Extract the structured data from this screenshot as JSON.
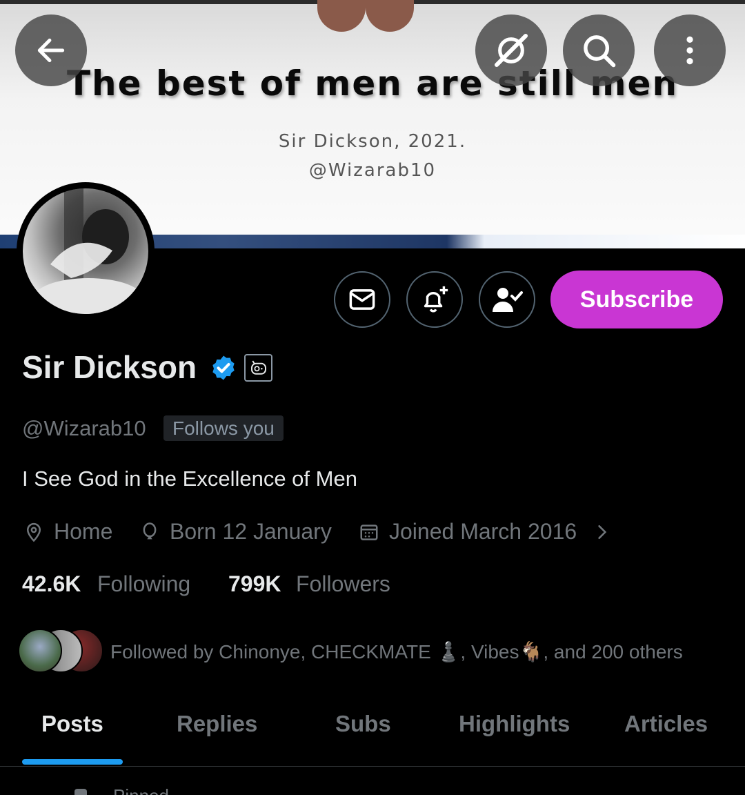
{
  "banner": {
    "quote": "The best of men are still men",
    "caption_line1": "Sir Dickson, 2021.",
    "caption_line2": "@Wizarab10"
  },
  "header_buttons": {
    "back": "back-arrow-icon",
    "grok": "grok-icon",
    "search": "search-icon",
    "more": "more-vertical-icon"
  },
  "actions": {
    "message": "mail-icon",
    "notify": "bell-plus-icon",
    "following": "user-check-icon",
    "subscribe_label": "Subscribe"
  },
  "colors": {
    "accent": "#1d9bf0",
    "subscribe": "#c936d3",
    "muted": "#71767b",
    "text": "#e7e9ea"
  },
  "profile": {
    "name": "Sir Dickson",
    "handle": "@Wizarab10",
    "follows_you": "Follows you",
    "bio": "I See God in the Excellence of Men",
    "location": "Home",
    "birthday": "Born 12 January",
    "joined": "Joined March 2016",
    "following_count": "42.6K",
    "following_label": "Following",
    "followers_count": "799K",
    "followers_label": "Followers",
    "followed_by": "Followed by Chinonye, CHECKMATE ♟️, Vibes🐐, and 200 others"
  },
  "tabs": [
    {
      "label": "Posts",
      "active": true
    },
    {
      "label": "Replies",
      "active": false
    },
    {
      "label": "Subs",
      "active": false
    },
    {
      "label": "Highlights",
      "active": false
    },
    {
      "label": "Articles",
      "active": false
    }
  ],
  "pinned_label": "Pinned"
}
